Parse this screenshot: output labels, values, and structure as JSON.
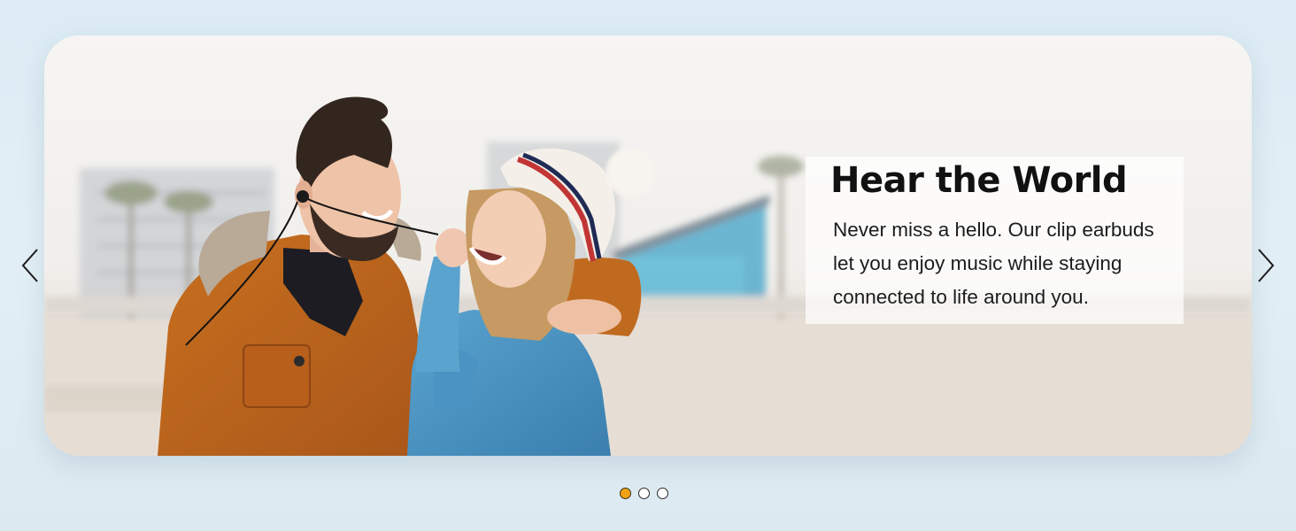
{
  "carousel": {
    "slide": {
      "title": "Hear the World",
      "body": "Never miss a hello. Our clip earbuds let you enjoy music while staying connected to life around you.",
      "image": "couple-on-beach-wearing-earbuds"
    },
    "prev_icon": "chevron-left-icon",
    "next_icon": "chevron-right-icon",
    "slide_count": 3,
    "active_index": 0
  },
  "colors": {
    "background": "#dde9f1",
    "active_dot": "#f0a312",
    "text": "#111111"
  }
}
